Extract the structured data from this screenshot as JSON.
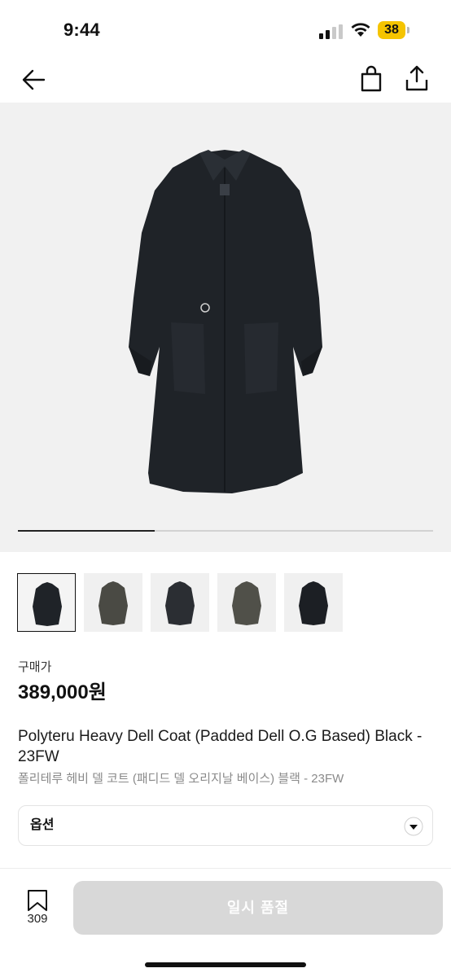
{
  "status_bar": {
    "time": "9:44",
    "battery_level": "38",
    "battery_color": "#f5c400",
    "icons": [
      "signal-icon",
      "wifi-icon",
      "battery-icon"
    ]
  },
  "nav": {
    "icons": [
      "back-arrow-icon",
      "shopping-bag-icon",
      "share-icon"
    ]
  },
  "gallery": {
    "current_image_progress": 0.33,
    "thumbnail_count": 5,
    "selected_thumbnail": 0
  },
  "product": {
    "price_label": "구매가",
    "price": "389,000원",
    "title_en": "Polyteru Heavy Dell Coat (Padded Dell O.G Based) Black - 23FW",
    "title_ko": "폴리테루 헤비 델 코트 (패디드 델 오리지날 베이스) 블랙 - 23FW"
  },
  "option": {
    "label": "옵션"
  },
  "bottom_bar": {
    "bookmark_count": "309",
    "action_label": "일시 품절"
  }
}
